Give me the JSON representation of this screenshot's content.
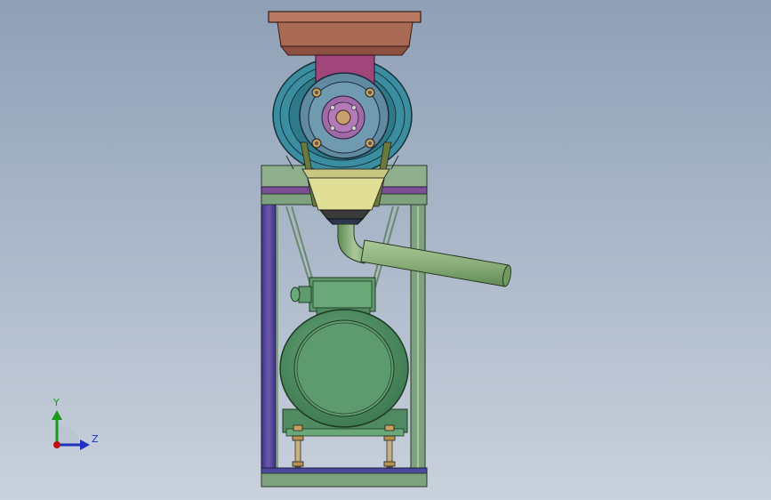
{
  "viewport": {
    "triad": {
      "y_label": "Y",
      "z_label": "Z"
    }
  },
  "colors": {
    "background_top": "#8fa0b6",
    "background_bottom": "#c9d1dc",
    "hopper": "#b36a52",
    "frame": "#7fa27e",
    "frame_post": "#5f4ea1",
    "flywheel": "#3b8da0",
    "bearing_block": "#5f8aa0",
    "hub": "#a06aa8",
    "chute": "#e1df95",
    "pipe": "#8bb07a",
    "motor": "#5d9a6e",
    "triad_y": "#1a9a1a",
    "triad_z": "#2030c0",
    "triad_origin": "#c01010"
  }
}
